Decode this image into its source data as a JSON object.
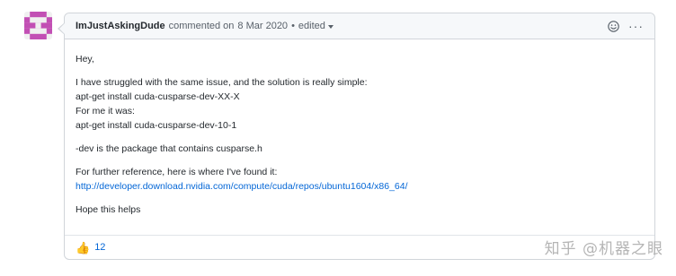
{
  "comment": {
    "author": "ImJustAskingDude",
    "action": "commented on",
    "date": "8 Mar 2020",
    "separator": "•",
    "edited": "edited",
    "paragraphs": {
      "greeting": "Hey,",
      "line1": "I have struggled with the same issue, and the solution is really simple:",
      "line2": "apt-get install cuda-cusparse-dev-XX-X",
      "line3": "For me it was:",
      "line4": "apt-get install cuda-cusparse-dev-10-1",
      "dev_note": "-dev is the package that contains cusparse.h",
      "reference": "For further reference, here is where I've found it:",
      "link": "http://developer.download.nvidia.com/compute/cuda/repos/ubuntu1604/x86_64/",
      "closing": "Hope this helps"
    },
    "reactions": {
      "thumbs_up_count": "12"
    },
    "icons": {
      "reaction_picker": "smiley-icon",
      "more": "kebab-horizontal-icon",
      "dropdown": "caret-down-icon",
      "thumbs_up": "thumbs-up-icon"
    },
    "kebab_glyph": "···",
    "thumb_glyph": "👍"
  },
  "watermark": {
    "text": "知乎 @机器之眼"
  },
  "colors": {
    "link": "#0366d6",
    "header_bg": "#f6f8fa",
    "border": "#d1d5da",
    "avatar": "#c24fb4"
  }
}
